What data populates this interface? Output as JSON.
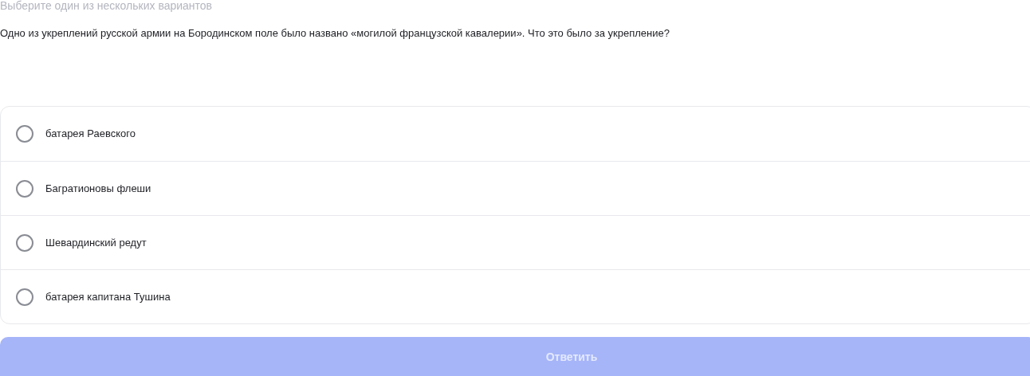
{
  "hint": "Выберите один из нескольких вариантов",
  "question": "Одно из укреплений русской армии на Бородинском поле было названо «могилой французской кавалерии». Что это было за укрепление?",
  "options": [
    {
      "label": "батарея Раевского",
      "selected": false
    },
    {
      "label": "Багратионовы флеши",
      "selected": false
    },
    {
      "label": "Шевардинский редут",
      "selected": false
    },
    {
      "label": "батарея капитана Тушина",
      "selected": false
    }
  ],
  "submit": {
    "label": "Ответить",
    "disabled": true
  }
}
